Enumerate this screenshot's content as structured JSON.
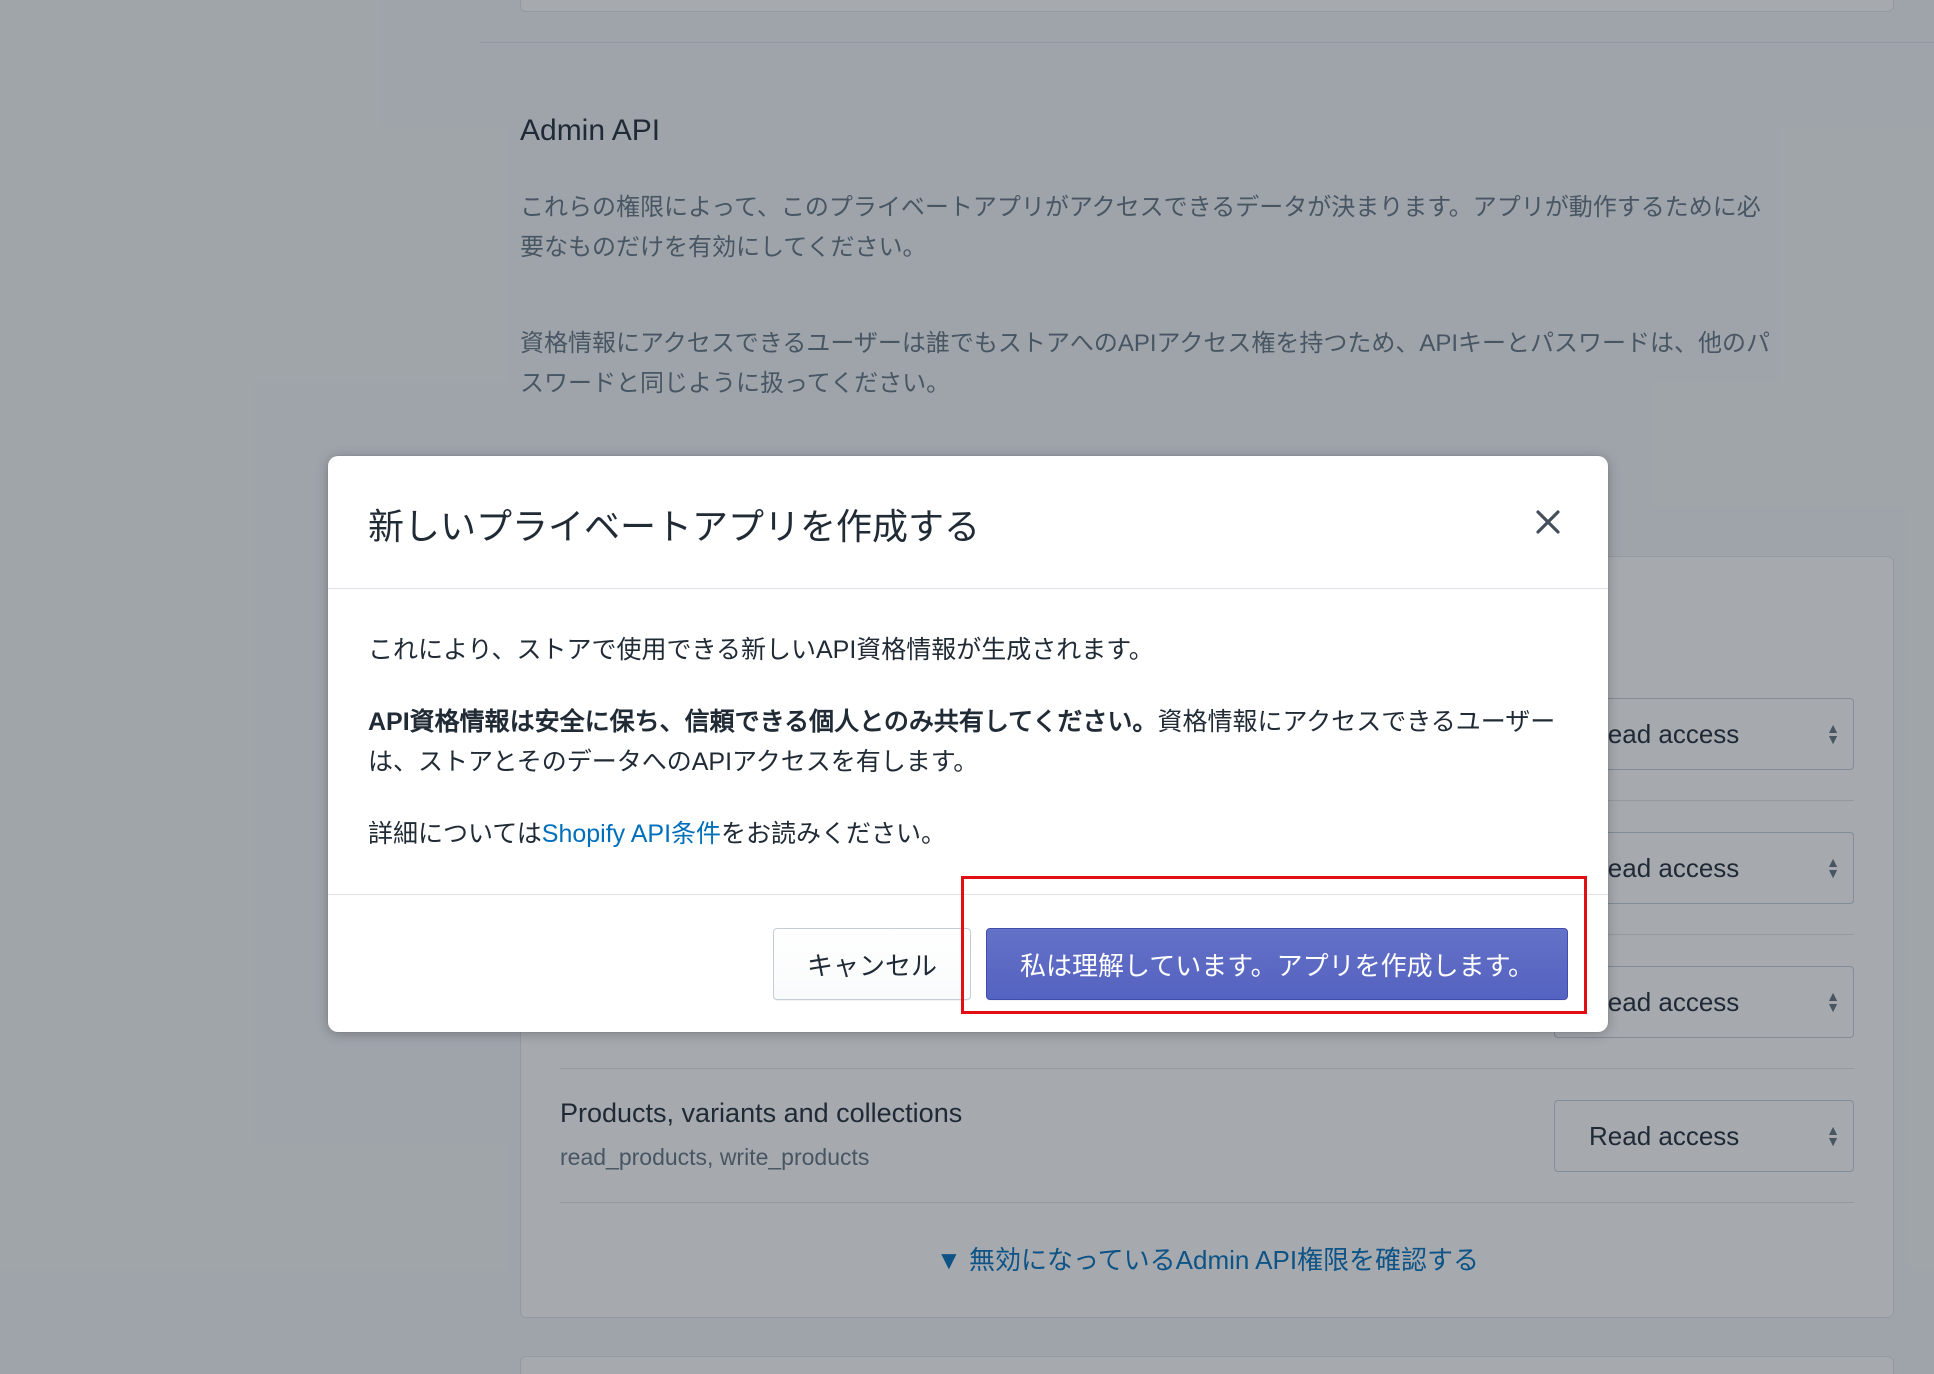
{
  "background": {
    "section_title": "Admin API",
    "description_1": "これらの権限によって、このプライベートアプリがアクセスできるデータが決まります。アプリが動作するために必要なものだけを有効にしてください。",
    "description_2": "資格情報にアクセスできるユーザーは誰でもストアへのAPIアクセス権を持つため、APIキーとパスワードは、他のパスワードと同じように扱ってください。",
    "permissions": [
      {
        "access": "Read access"
      },
      {
        "access": "Read access"
      },
      {
        "access": "Read access"
      },
      {
        "name": "Products, variants and collections",
        "scopes": "read_products, write_products",
        "access": "Read access"
      }
    ],
    "disabled_permissions_link": "▼ 無効になっているAdmin API権限を確認する"
  },
  "modal": {
    "title": "新しいプライベートアプリを作成する",
    "close_icon": "close-icon",
    "body": {
      "p1": "これにより、ストアで使用できる新しいAPI資格情報が生成されます。",
      "p2_bold": "API資格情報は安全に保ち、信頼できる個人とのみ共有してください。",
      "p2_rest": "資格情報にアクセスできるユーザーは、ストアとそのデータへのAPIアクセスを有します。",
      "p3_prefix": "詳細については",
      "p3_link": "Shopify API条件",
      "p3_suffix": "をお読みください。"
    },
    "cancel_label": "キャンセル",
    "confirm_label": "私は理解しています。アプリを作成します。"
  },
  "colors": {
    "primary": "#5c6ac4",
    "link": "#006fbb",
    "highlight": "#e10f14",
    "overlay": "rgba(33,43,54,0.4)"
  }
}
